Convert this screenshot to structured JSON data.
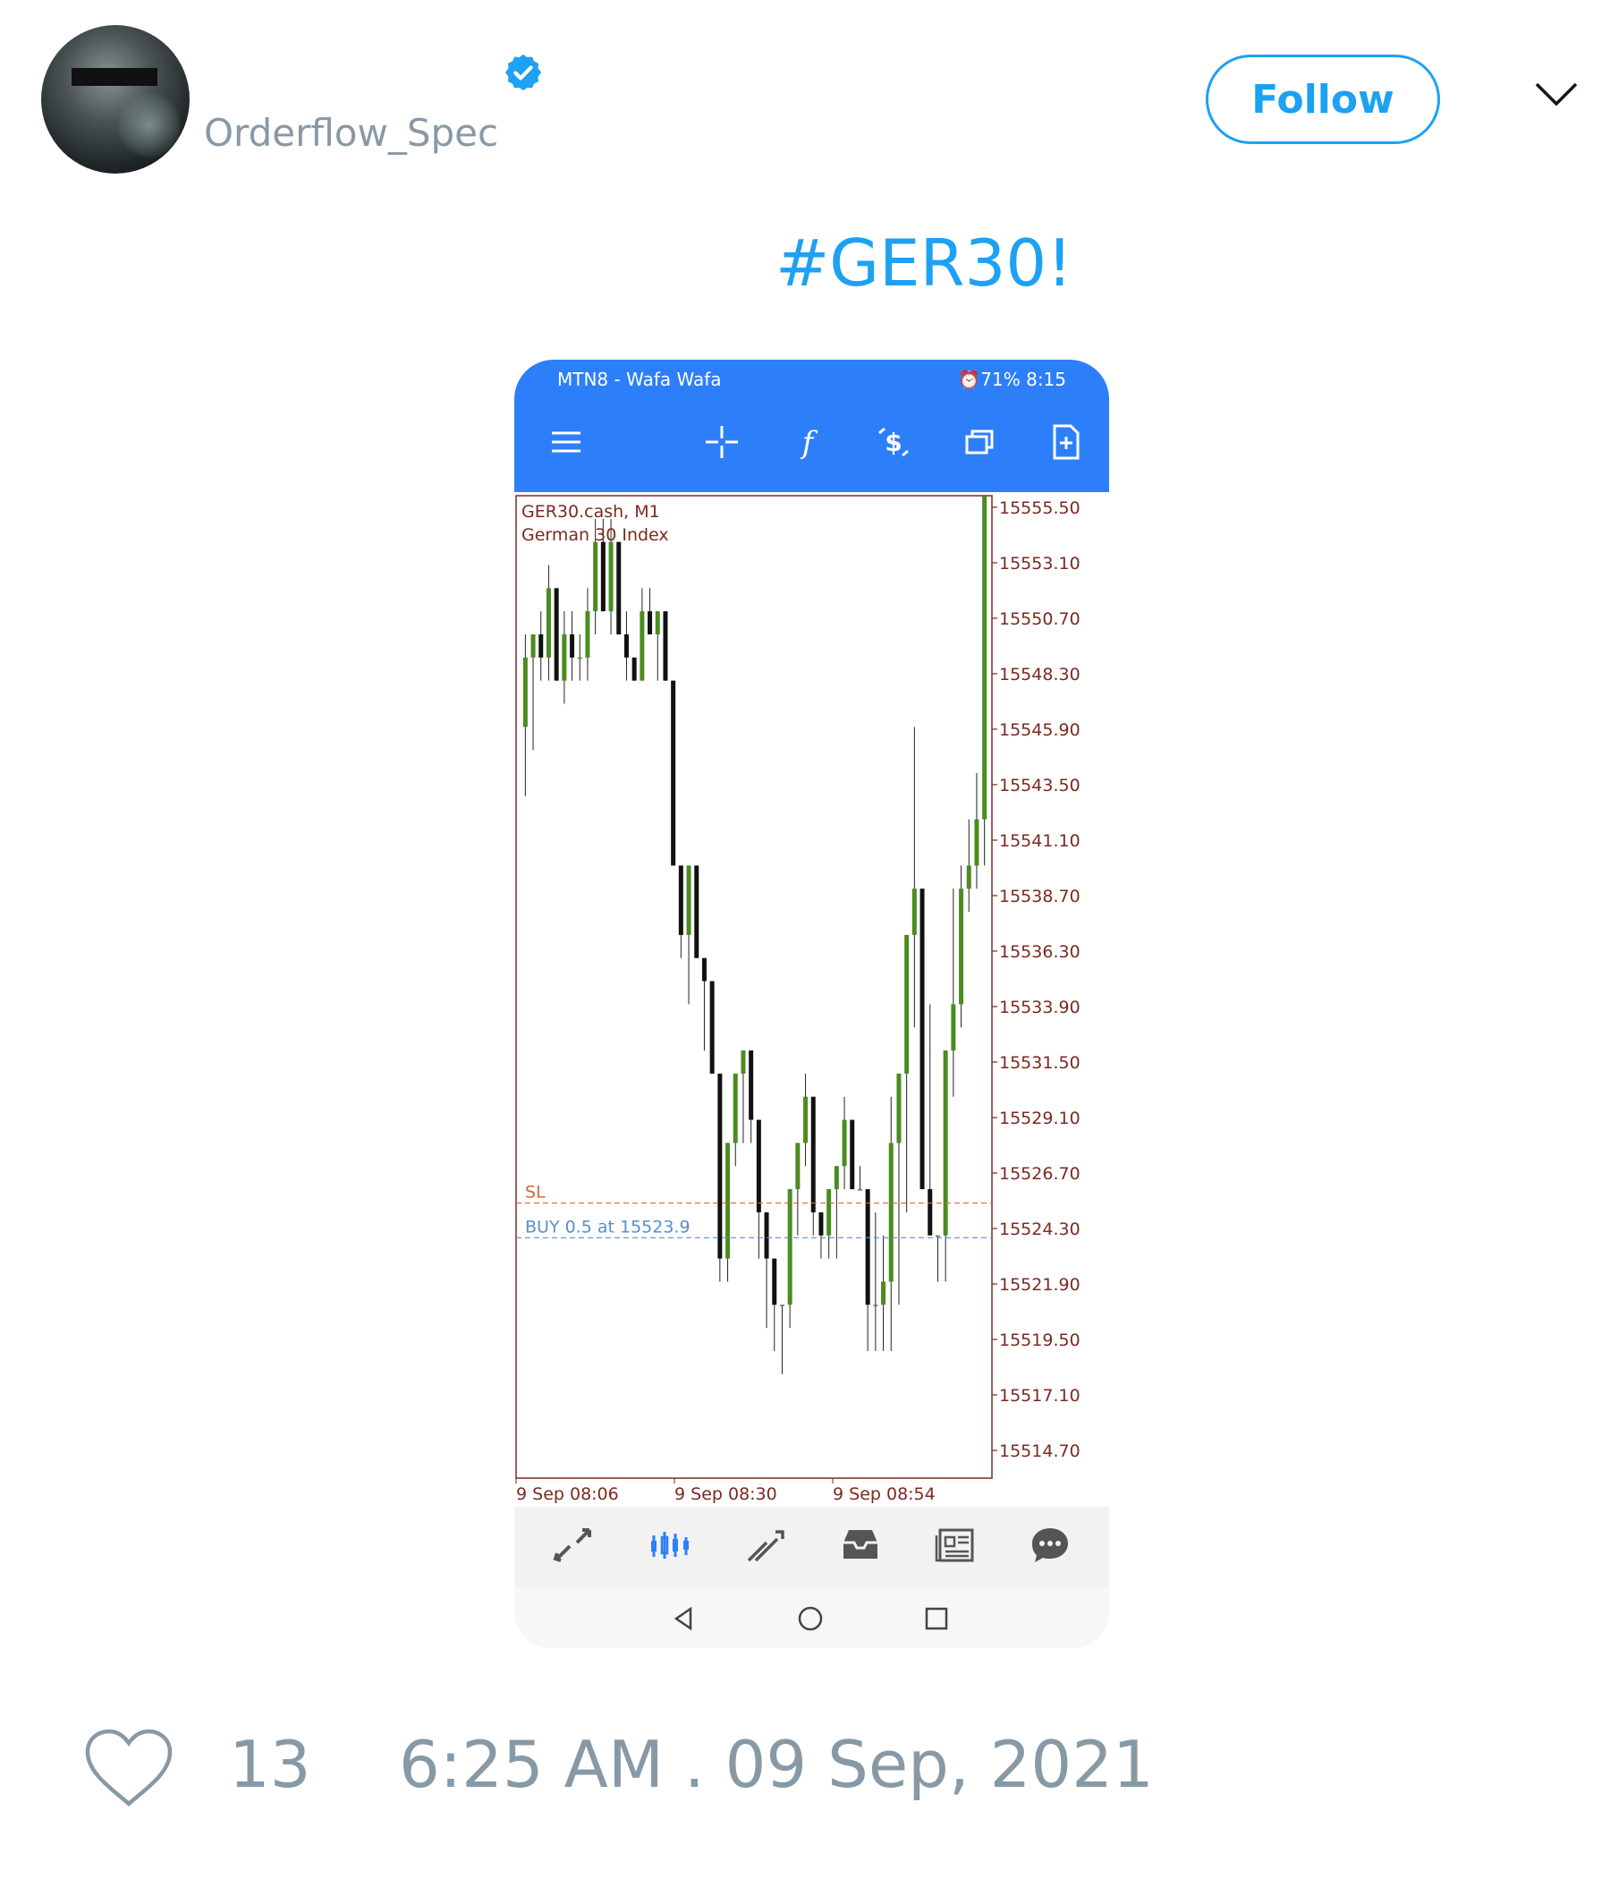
{
  "user": {
    "handle": "Orderflow_Spec",
    "verified": true
  },
  "follow_label": "Follow",
  "tweet": {
    "text": "#GER30!"
  },
  "phone": {
    "status_left": "MTN8 - Wafa Wafa",
    "status_right": "⏰71%  8:15",
    "toolbar_icons": [
      "menu-icon",
      "crosshair-icon",
      "function-icon",
      "trade-icon",
      "windows-icon",
      "new-order-icon"
    ],
    "nav_icons": [
      "quotes-icon",
      "chart-icon",
      "trade-icon",
      "history-icon",
      "news-icon",
      "messages-icon"
    ]
  },
  "chart_data": {
    "type": "candlestick",
    "symbol_label": "GER30.cash, M1",
    "subtitle": "German 30 Index",
    "yticks": [
      "15555.50",
      "15553.10",
      "15550.70",
      "15548.30",
      "15545.90",
      "15543.50",
      "15541.10",
      "15538.70",
      "15536.30",
      "15533.90",
      "15531.50",
      "15529.10",
      "15526.70",
      "15524.30",
      "15521.90",
      "15519.50",
      "15517.10",
      "15514.70"
    ],
    "xticks": [
      "9 Sep 08:06",
      "9 Sep 08:30",
      "9 Sep 08:54"
    ],
    "ylim": [
      15513.5,
      15556.0
    ],
    "sl_label": "SL",
    "sl_value": 15525.4,
    "buy_label": "BUY 0.5 at 15523.9",
    "buy_value": 15523.9,
    "colors": {
      "up": "#4b8c1f",
      "down": "#111111",
      "axis": "#7a2a20",
      "sl": "#d2693a",
      "buy": "#5a8fc8"
    },
    "candles": [
      [
        15546,
        15550,
        15543,
        15549
      ],
      [
        15549,
        15550,
        15545,
        15550
      ],
      [
        15550,
        15551,
        15548,
        15549
      ],
      [
        15549,
        15553,
        15548,
        15552
      ],
      [
        15552,
        15552,
        15548,
        15548
      ],
      [
        15548,
        15551,
        15547,
        15550
      ],
      [
        15550,
        15551,
        15548,
        15549
      ],
      [
        15549,
        15550,
        15548,
        15549
      ],
      [
        15549,
        15552,
        15548,
        15551
      ],
      [
        15551,
        15555,
        15550,
        15554
      ],
      [
        15554,
        15555,
        15551,
        15551
      ],
      [
        15551,
        15555,
        15550,
        15554
      ],
      [
        15554,
        15554,
        15550,
        15550
      ],
      [
        15550,
        15551,
        15548,
        15549
      ],
      [
        15549,
        15549,
        15548,
        15548
      ],
      [
        15548,
        15552,
        15548,
        15551
      ],
      [
        15551,
        15552,
        15550,
        15550
      ],
      [
        15550,
        15551,
        15548,
        15551
      ],
      [
        15551,
        15551,
        15548,
        15548
      ],
      [
        15548,
        15548,
        15540,
        15540
      ],
      [
        15540,
        15540,
        15536,
        15537
      ],
      [
        15537,
        15540,
        15534,
        15540
      ],
      [
        15540,
        15540,
        15536,
        15536
      ],
      [
        15536,
        15536,
        15532,
        15535
      ],
      [
        15535,
        15535,
        15531,
        15531
      ],
      [
        15531,
        15531,
        15522,
        15523
      ],
      [
        15523,
        15528,
        15522,
        15528
      ],
      [
        15528,
        15531,
        15527,
        15531
      ],
      [
        15531,
        15532,
        15528,
        15532
      ],
      [
        15532,
        15532,
        15528,
        15529
      ],
      [
        15529,
        15529,
        15523,
        15525
      ],
      [
        15525,
        15525,
        15520,
        15523
      ],
      [
        15523,
        15523,
        15519,
        15521
      ],
      [
        15521,
        15521,
        15518,
        15521
      ],
      [
        15521,
        15526,
        15520,
        15526
      ],
      [
        15526,
        15528,
        15524,
        15528
      ],
      [
        15528,
        15531,
        15527,
        15530
      ],
      [
        15530,
        15530,
        15524,
        15525
      ],
      [
        15525,
        15525,
        15523,
        15524
      ],
      [
        15524,
        15526,
        15523,
        15526
      ],
      [
        15526,
        15527,
        15523,
        15527
      ],
      [
        15527,
        15530,
        15526,
        15529
      ],
      [
        15529,
        15529,
        15526,
        15526
      ],
      [
        15526,
        15527,
        15526,
        15526
      ],
      [
        15526,
        15526,
        15519,
        15521
      ],
      [
        15521,
        15525,
        15519,
        15521
      ],
      [
        15521,
        15524,
        15519,
        15522
      ],
      [
        15522,
        15530,
        15519,
        15528
      ],
      [
        15528,
        15531,
        15521,
        15531
      ],
      [
        15531,
        15534,
        15525,
        15537
      ],
      [
        15537,
        15546,
        15533,
        15539
      ],
      [
        15539,
        15539,
        15530,
        15526
      ],
      [
        15526,
        15534,
        15524,
        15524
      ],
      [
        15524,
        15524,
        15522,
        15524
      ],
      [
        15524,
        15532,
        15522,
        15532
      ],
      [
        15532,
        15539,
        15530,
        15534
      ],
      [
        15534,
        15540,
        15533,
        15539
      ],
      [
        15539,
        15542,
        15538,
        15540
      ],
      [
        15540,
        15544,
        15539,
        15542
      ],
      [
        15542,
        15556,
        15540,
        15556
      ]
    ]
  },
  "footer": {
    "likes": "13",
    "timestamp": "6:25 AM . 09 Sep, 2021"
  }
}
